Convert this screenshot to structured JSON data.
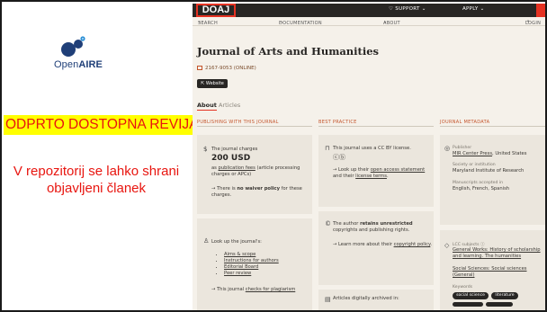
{
  "slide": {
    "logo_text_a": "Open",
    "logo_text_b": "AIRE",
    "banner": "ODPRTO DOSTOPNA REVIJA",
    "note": "V repozitorij se lahko shrani objavljeni članek",
    "colors": {
      "banner_bg": "#ffff00",
      "banner_text": "#e8150f",
      "logo_blue": "#1f3f78"
    }
  },
  "site": {
    "brand": "DOAJ",
    "nav": {
      "support": "SUPPORT",
      "apply": "APPLY",
      "search": "SEARCH",
      "documentation": "DOCUMENTATION",
      "about": "ABOUT",
      "login": "LOGIN"
    },
    "colors": {
      "bar": "#282624",
      "accent": "#e53222",
      "page_bg": "#f5f1ea"
    }
  },
  "journal": {
    "title": "Journal of Arts and Humanities",
    "issn": "2167-9053 (ONLINE)",
    "website_button": "Website",
    "tabs": {
      "about": "About",
      "articles": "Articles"
    }
  },
  "columns": {
    "publishing": "PUBLISHING WITH THIS JOURNAL",
    "best_practice": "BEST PRACTICE",
    "metadata": "JOURNAL METADATA"
  },
  "charges": {
    "lead": "The journal charges",
    "amount": "200 USD",
    "as": "as",
    "apc_link": "publication fees",
    "apc_tail": "(article processing charges or APCs)",
    "waiver_pre": "→ There is",
    "waiver_bold": "no waiver policy",
    "waiver_post": "for these charges."
  },
  "license": {
    "text": "This journal uses a CC BY license.",
    "cc": "cc",
    "by": "by",
    "lookup": "→ Look up their",
    "open_access": "open access statement",
    "and": "and their",
    "license_terms": "license terms"
  },
  "lookup": {
    "lead": "Look up the journal's:",
    "items": [
      "Aims & scope",
      "Instructions for authors",
      "Editorial Board",
      "Peer review"
    ],
    "plag_pre": "→ This journal",
    "plag_link": "checks for plagiarism"
  },
  "copyright": {
    "pre": "The author",
    "bold": "retains unrestricted",
    "post": "copyrights and publishing rights.",
    "learn": "→ Learn more about their",
    "link": "copyright policy"
  },
  "archive": {
    "text": "Articles digitally archived in:"
  },
  "meta": {
    "publisher_label": "Publisher",
    "publisher": "MIR Center Press",
    "publisher_country": ", United States",
    "society_label": "Society or institution",
    "society": "Maryland Institute of Research",
    "manuscripts_label": "Manuscripts accepted in",
    "languages": "English, French, Spanish",
    "lcc_label": "LCC subjects",
    "lcc_1": "General Works: History of scholarship and learning. The humanities",
    "lcc_2": "Social Sciences: Social sciences (General)",
    "keywords_label": "Keywords",
    "keywords": [
      "social science",
      "literature"
    ]
  }
}
